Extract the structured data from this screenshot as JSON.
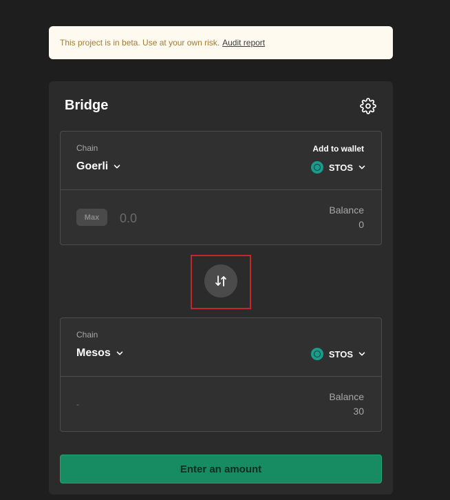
{
  "banner": {
    "text": "This project is in beta. Use at your own risk.",
    "link_label": "Audit report"
  },
  "bridge": {
    "title": "Bridge",
    "settings_icon": "gear-icon",
    "from": {
      "chain_label": "Chain",
      "chain": "Goerli",
      "add_wallet_label": "Add to wallet",
      "token": "STOS",
      "max_label": "Max",
      "amount_placeholder": "0.0",
      "balance_label": "Balance",
      "balance": "0"
    },
    "swap_icon": "swap-arrows-icon",
    "to": {
      "chain_label": "Chain",
      "chain": "Mesos",
      "token": "STOS",
      "amount_value": "-",
      "balance_label": "Balance",
      "balance": "30"
    },
    "cta_label": "Enter an amount"
  },
  "colors": {
    "background": "#1e1e1e",
    "card": "#2b2b2b",
    "banner_bg": "#fffaf0",
    "banner_text": "#a07a34",
    "cta_bg": "#178c63",
    "token_icon": "#1a9c8c",
    "highlight_frame": "#c4282a"
  }
}
